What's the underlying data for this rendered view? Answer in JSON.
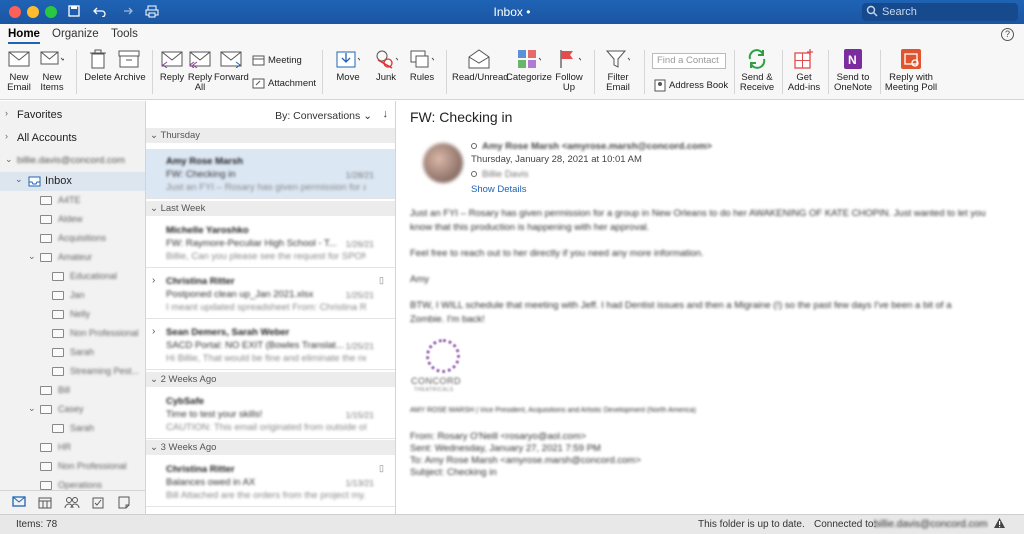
{
  "window": {
    "title": "Inbox •",
    "search_placeholder": "Search"
  },
  "ribbon_tabs": [
    "Home",
    "Organize",
    "Tools"
  ],
  "ribbon": {
    "new_email": "New Email",
    "new_items": "New Items",
    "delete": "Delete",
    "archive": "Archive",
    "reply": "Reply",
    "reply_all": "Reply All",
    "forward": "Forward",
    "meeting": "Meeting",
    "attachment": "Attachment",
    "move": "Move",
    "junk": "Junk",
    "rules": "Rules",
    "read_unread": "Read/Unread",
    "categorize": "Categorize",
    "follow_up": "Follow Up",
    "filter_email": "Filter Email",
    "find_contact_placeholder": "Find a Contact",
    "address_book": "Address Book",
    "send_receive": "Send & Receive",
    "get_addins": "Get Add-ins",
    "send_onenote": "Send to OneNote",
    "reply_meeting_poll": "Reply with Meeting Poll"
  },
  "folders": {
    "favorites": "Favorites",
    "all_accounts": "All Accounts",
    "account": "billie.davis@concord.com",
    "inbox": "Inbox",
    "subfolders": [
      "A4TE",
      "Aldew",
      "Acquisitions",
      "Amateur",
      "Educational",
      "Jan",
      "Nelly",
      "Non Professional",
      "Sarah",
      "Streaming Pest...",
      "Bill",
      "Casey",
      "Sarah",
      "HR",
      "Non Professional",
      "Operations"
    ]
  },
  "list": {
    "sort_label": "By: Conversations",
    "groups": [
      "Thursday",
      "Last Week",
      "2 Weeks Ago",
      "3 Weeks Ago"
    ],
    "messages": [
      {
        "from": "Amy Rose Marsh",
        "subject": "FW: Checking in",
        "preview": "Just an FYI – Rosary has given permission for a...",
        "date": "1/28/21"
      },
      {
        "from": "Michelle Yaroshko",
        "subject": "FW: Raymore-Peculiar High School - T...",
        "preview": "Billie, Can you please see the request for SPON...",
        "date": "1/26/21"
      },
      {
        "from": "Christina Ritter",
        "subject": "Postponed clean up_Jan 2021.xlsx",
        "preview": "I meant updated spreadsheet From: Christina Rit...",
        "date": "1/25/21"
      },
      {
        "from": "Sean Demers, Sarah Weber",
        "subject": "SACD Portal: NO EXIT (Bowles Translat...",
        "preview": "Hi Billie, That would be fine and eliminate the ne...",
        "date": "1/25/21"
      },
      {
        "from": "CybSafe",
        "subject": "Time to test your skills!",
        "preview": "CAUTION: This email originated from outside of...",
        "date": "1/15/21"
      },
      {
        "from": "Christina Ritter",
        "subject": "Balances owed in AX",
        "preview": "Bill Attached are the orders from the project my...",
        "date": "1/13/21"
      }
    ]
  },
  "reading": {
    "subject": "FW: Checking in",
    "from": "Amy Rose Marsh <amyrose.marsh@concord.com>",
    "date": "Thursday, January 28, 2021 at 10:01 AM",
    "to": "Billie Davis",
    "show_details": "Show Details",
    "body": [
      "Just an FYI – Rosary has given permission for a group in New Orleans to do her AWAKENING OF KATE CHOPIN.  Just wanted to let you",
      "know that this production is happening with her approval.",
      "",
      "Feel free to reach out to her directly if you need any more information.",
      "",
      "Amy",
      "",
      "BTW, I WILL schedule that meeting with Jeff.  I had Dentist issues and then a Migraine (!) so the past few days I've been a bit of a",
      "Zombie.  I'm back!"
    ],
    "logo_text": "CONCORD",
    "logo_sub": "THEATRICALS",
    "signature": "AMY ROSE MARSH | Vice President, Acquisitions and Artistic Development (North America)",
    "forward": {
      "from": "From: Rosary O'Neill <rosaryo@aol.com>",
      "sent": "Sent: Wednesday, January 27, 2021 7:59 PM",
      "to": "To: Amy Rose Marsh <amyrose.marsh@concord.com>",
      "subject": "Subject: Checking in"
    }
  },
  "status": {
    "items": "Items: 78",
    "uptodate": "This folder is up to date.",
    "connected": "Connected to:",
    "connected_account": "billie.davis@concord.com"
  }
}
